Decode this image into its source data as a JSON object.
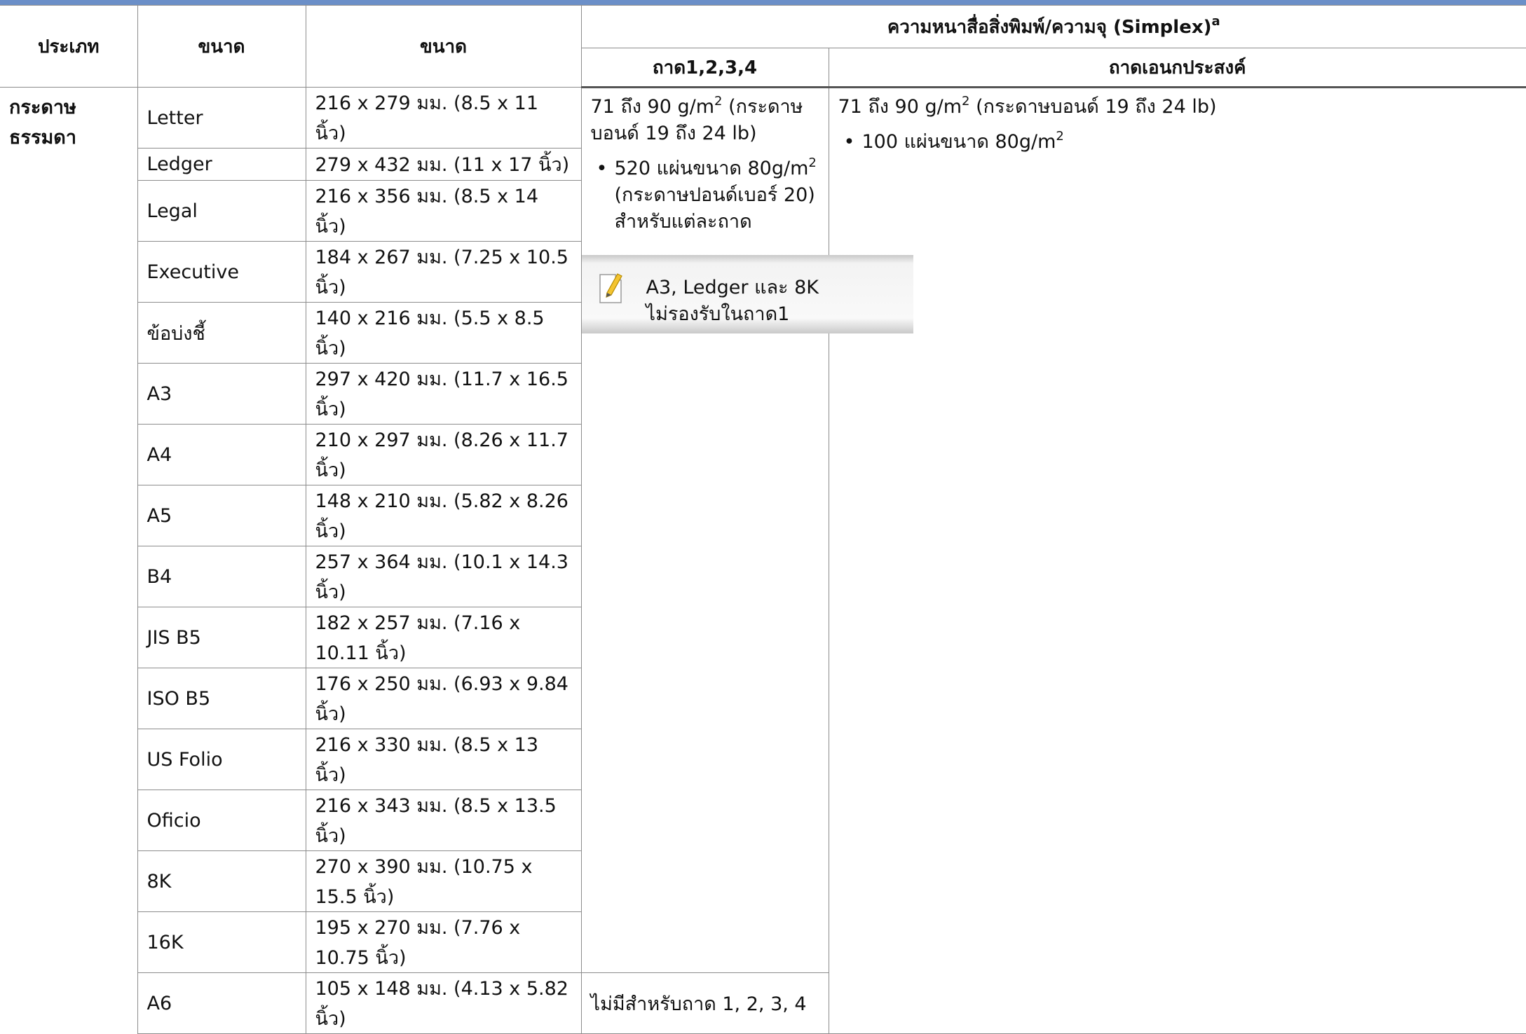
{
  "headers": {
    "type": "ประเภท",
    "size": "ขนาด",
    "dimensions": "ขนาด",
    "weight_group": "ความหนาสื่อสิ่งพิมพ์/ความจุ (Simplex)",
    "weight_group_footnote": "a",
    "tray1234": "ถาด1,2,3,4",
    "mp_tray": "ถาดเอนกประสงค์"
  },
  "type_label": "กระดาษธรรมดา",
  "rows": [
    {
      "size": "Letter",
      "dim": "216 x 279 มม. (8.5 x 11 นิ้ว)"
    },
    {
      "size": "Ledger",
      "dim": "279 x 432 มม. (11 x 17 นิ้ว)"
    },
    {
      "size": "Legal",
      "dim": "216 x 356 มม. (8.5 x 14 นิ้ว)"
    },
    {
      "size": "Executive",
      "dim": "184 x 267 มม. (7.25 x 10.5 นิ้ว)"
    },
    {
      "size": "ข้อบ่งชี้",
      "dim": "140 x 216 มม. (5.5 x 8.5 นิ้ว)"
    },
    {
      "size": "A3",
      "dim": "297 x 420 มม. (11.7 x 16.5 นิ้ว)"
    },
    {
      "size": "A4",
      "dim": "210 x 297 มม. (8.26 x 11.7 นิ้ว)"
    },
    {
      "size": "A5",
      "dim": "148 x 210 มม. (5.82 x 8.26 นิ้ว)"
    },
    {
      "size": "B4",
      "dim": "257 x 364 มม. (10.1 x 14.3 นิ้ว)"
    },
    {
      "size": "JIS B5",
      "dim": "182 x 257 มม. (7.16 x 10.11 นิ้ว)"
    },
    {
      "size": "ISO B5",
      "dim": "176 x 250 มม. (6.93 x 9.84 นิ้ว)"
    },
    {
      "size": "US Folio",
      "dim": "216 x 330 มม. (8.5 x 13 นิ้ว)"
    },
    {
      "size": "Oficio",
      "dim": "216 x 343 มม. (8.5 x 13.5 นิ้ว)"
    },
    {
      "size": "8K",
      "dim": "270 x 390 มม. (10.75 x 15.5 นิ้ว)"
    },
    {
      "size": "16K",
      "dim": "195 x 270 มม. (7.76 x 10.75 นิ้ว)"
    },
    {
      "size": "A6",
      "dim": "105 x 148 มม. (4.13 x 5.82 นิ้ว)"
    }
  ],
  "tray1234": {
    "weight_prefix": "71 ถึง 90 g/m",
    "weight_sup": "2",
    "weight_suffix": " (กระดาษบอนด์ 19 ถึง 24 lb)",
    "bullet_prefix": "520 แผ่นขนาด 80g/m",
    "bullet_sup": "2",
    "bullet_line2": "(กระดาษปอนด์เบอร์ 20)",
    "bullet_line3": "สำหรับแต่ละถาด",
    "note_line1": "A3, Ledger และ 8K",
    "note_line2": "ไม่รองรับในถาด1",
    "a6_text": "ไม่มีสำหรับถาด 1, 2, 3, 4"
  },
  "mp_tray": {
    "weight_prefix": "71 ถึง 90 g/m",
    "weight_sup": "2",
    "weight_suffix": " (กระดาษบอนด์ 19 ถึง 24 lb)",
    "bullet_prefix": "100 แผ่นขนาด 80g/m",
    "bullet_sup": "2"
  },
  "colors": {
    "top_bar": "#6b8fc8",
    "border": "#8c8c8c"
  },
  "icons": {
    "note": "note-pencil-icon"
  }
}
